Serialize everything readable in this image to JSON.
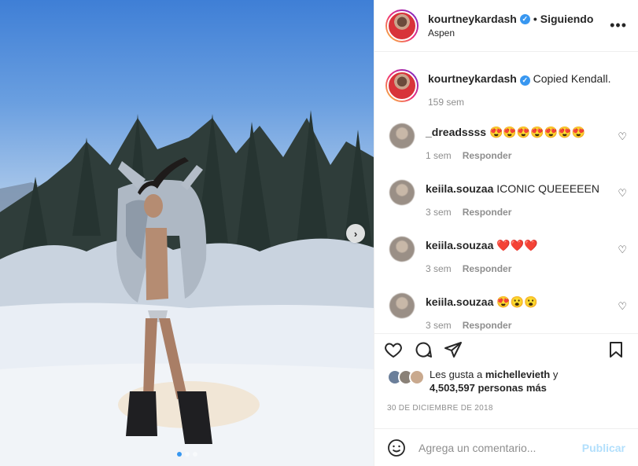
{
  "post": {
    "username": "kourtneykardash",
    "follow_sep": "•",
    "follow_state": "Siguiendo",
    "location": "Aspen",
    "more_icon": "more-horizontal-icon",
    "carousel": {
      "next_icon": "chevron-right-icon",
      "slide_count": 3,
      "active_index": 0
    }
  },
  "caption": {
    "username": "kourtneykardash",
    "text": "Copied Kendall.",
    "age": "159 sem"
  },
  "comments": [
    {
      "username": "_dreadssss",
      "text": "😍😍😍😍😍😍😍",
      "age": "1 sem",
      "reply": "Responder"
    },
    {
      "username": "keiila.souzaa",
      "text": "ICONIC QUEEEEEN",
      "age": "3 sem",
      "reply": "Responder"
    },
    {
      "username": "keiila.souzaa",
      "text": "❤️❤️❤️",
      "age": "3 sem",
      "reply": "Responder"
    },
    {
      "username": "keiila.souzaa",
      "text": "😍😮😮",
      "age": "3 sem",
      "reply": "Responder"
    }
  ],
  "likes": {
    "prefix": "Les gusta a",
    "liker": "michellevieth",
    "conj": "y",
    "count": "4,503,597 personas más"
  },
  "date": "30 DE DICIEMBRE DE 2018",
  "add_comment": {
    "placeholder": "Agrega un comentario...",
    "submit_label": "Publicar"
  },
  "colors": {
    "accent": "#3897f0",
    "submit_disabled": "#b2dffc",
    "muted": "#8e8e8e"
  }
}
